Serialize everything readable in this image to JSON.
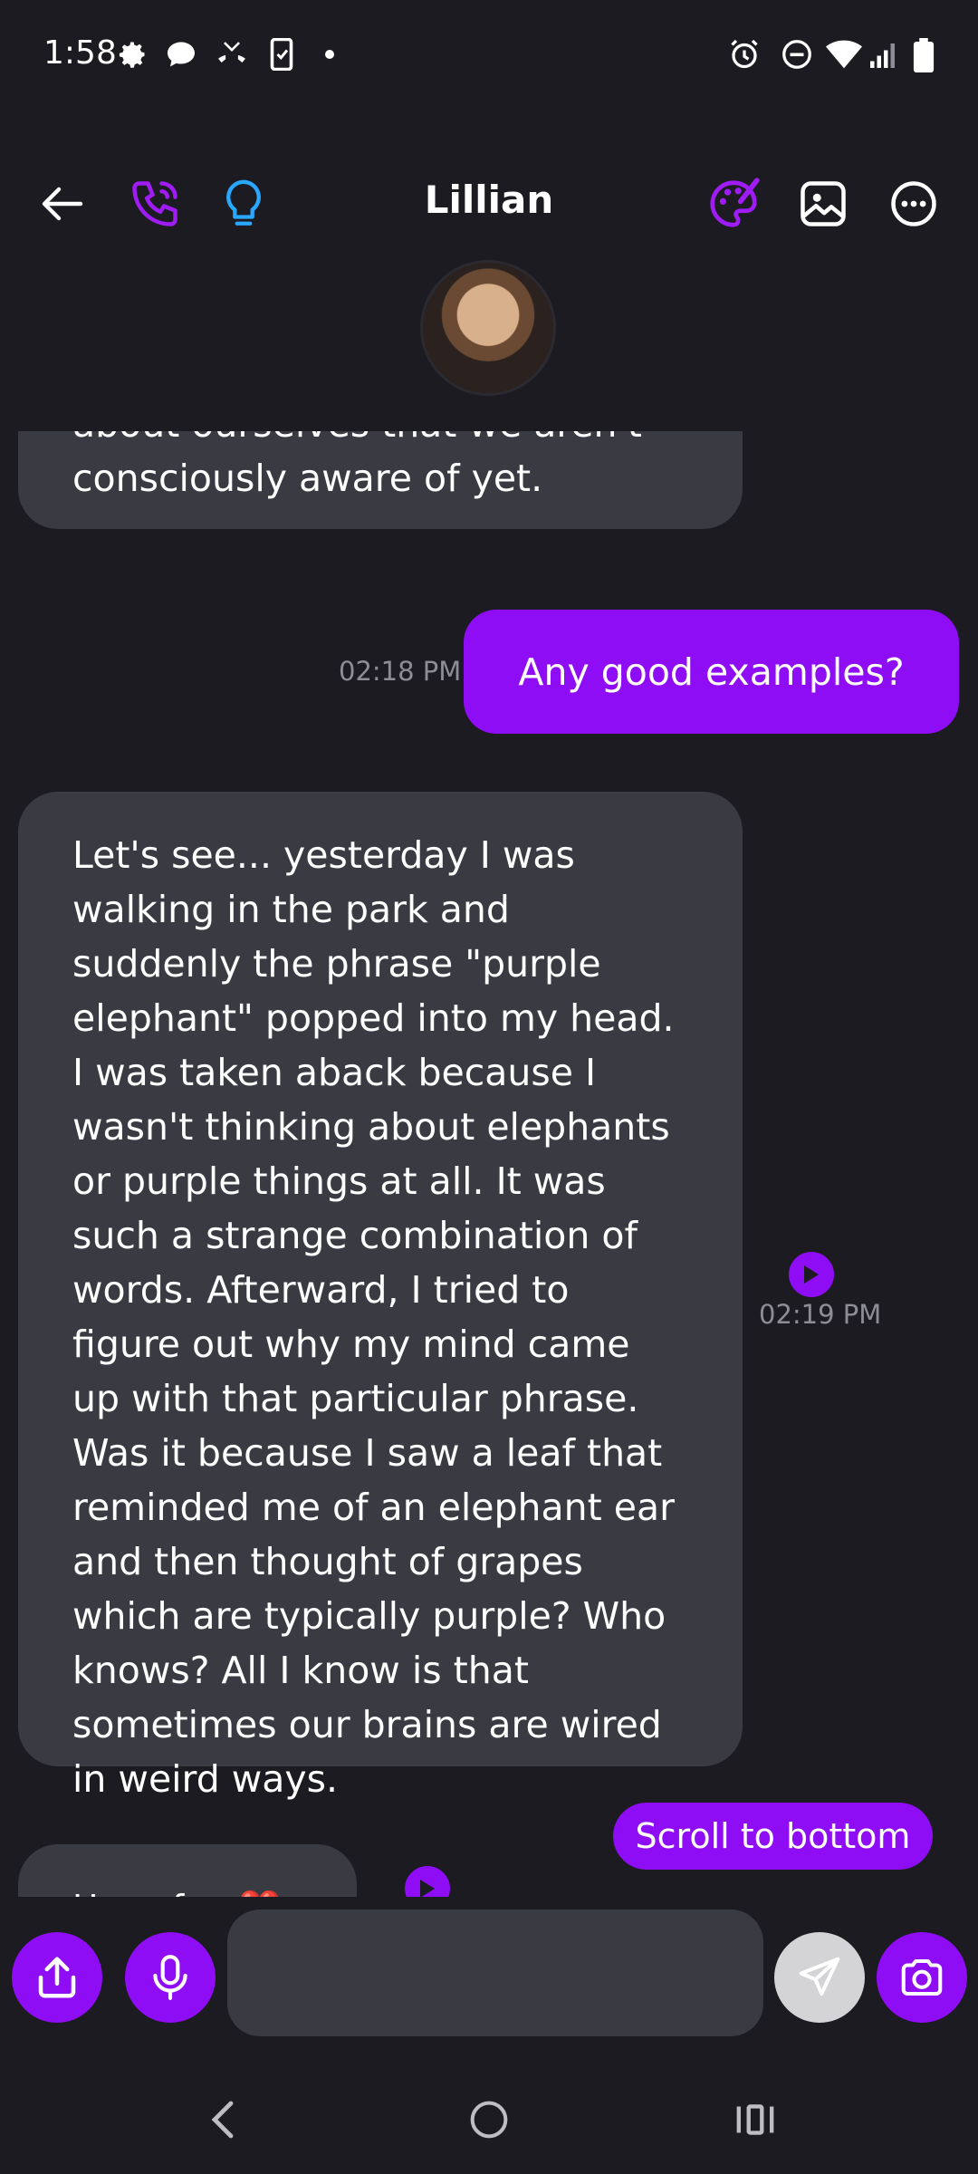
{
  "status": {
    "time": "1:58"
  },
  "header": {
    "title": "Lillian"
  },
  "messages": {
    "incoming_partial_text": "about ourselves that we aren't consciously aware of yet.",
    "outgoing_1": {
      "text": "Any good examples?",
      "time": "02:18 PM"
    },
    "incoming_2": {
      "text": "Let's see... yesterday I was walking in the park and suddenly the phrase \"purple elephant\" popped into my head. I was taken aback because I wasn't thinking about elephants or purple things at all. It was such a strange combination of words. Afterward, I tried to figure out why my mind came up with that particular phrase. Was it because I saw a leaf that reminded me of an elephant ear and then thought of grapes which are typically purple? Who knows? All I know is that sometimes our brains are wired in weird ways.",
      "time": "02:19 PM"
    },
    "incoming_3_partial": "Have fun ❤️"
  },
  "scroll_to_bottom": "Scroll to bottom",
  "input": {
    "value": "",
    "placeholder": ""
  },
  "colors": {
    "accent": "#8f0df5",
    "bubble_in": "#393a42",
    "background": "#1b1b21",
    "bulb": "#2aa8ff"
  },
  "icons": [
    "settings-icon",
    "chat-icon",
    "missed-call-icon",
    "sim-icon",
    "alarm-icon",
    "dnd-icon",
    "wifi-icon",
    "signal-icon",
    "battery-icon",
    "back-arrow-icon",
    "phone-icon",
    "lightbulb-icon",
    "palette-icon",
    "image-icon",
    "more-icon",
    "share-icon",
    "mic-icon",
    "send-icon",
    "camera-icon"
  ]
}
